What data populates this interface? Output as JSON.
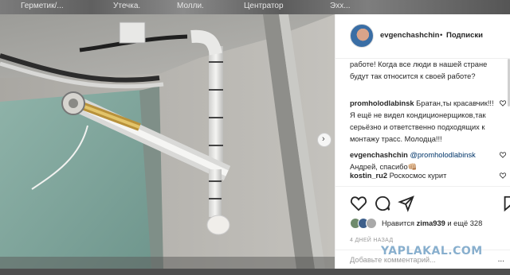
{
  "top_tabs": [
    "Герметик/...",
    "Утечка.",
    "Молли.",
    "Центратор",
    "Эхх..."
  ],
  "post": {
    "username": "evgenchashchin",
    "separator": "•",
    "follow_label": "Подписки",
    "comments": [
      {
        "user": "",
        "text": "работе! Когда все люди в нашей стране будут так относится к своей работе?"
      },
      {
        "user": "promholodlabinsk",
        "text": "Братан,ты красавчик!!! Я ещё не видел кондиционерщиков,так серьёзно и ответственно подходящих к монтажу трасс. Молодца!!!"
      },
      {
        "user": "evgenchashchin",
        "mention": "@promholodlabinsk",
        "text": "Андрей, спасибо👊🏼"
      },
      {
        "user": "kostin_ru2",
        "text": "Роскосмос курит"
      }
    ],
    "likes": {
      "prefix": "Нравится",
      "user": "zima939",
      "suffix": "и ещё 328"
    },
    "date": "4 ДНЕЙ НАЗАД",
    "add_comment_placeholder": "Добавьте комментарий...",
    "more_label": "..."
  },
  "watermark": "YAPLAKAL.COM",
  "colors": {
    "accent": "#262626",
    "link": "#003569",
    "muted": "#999999"
  }
}
